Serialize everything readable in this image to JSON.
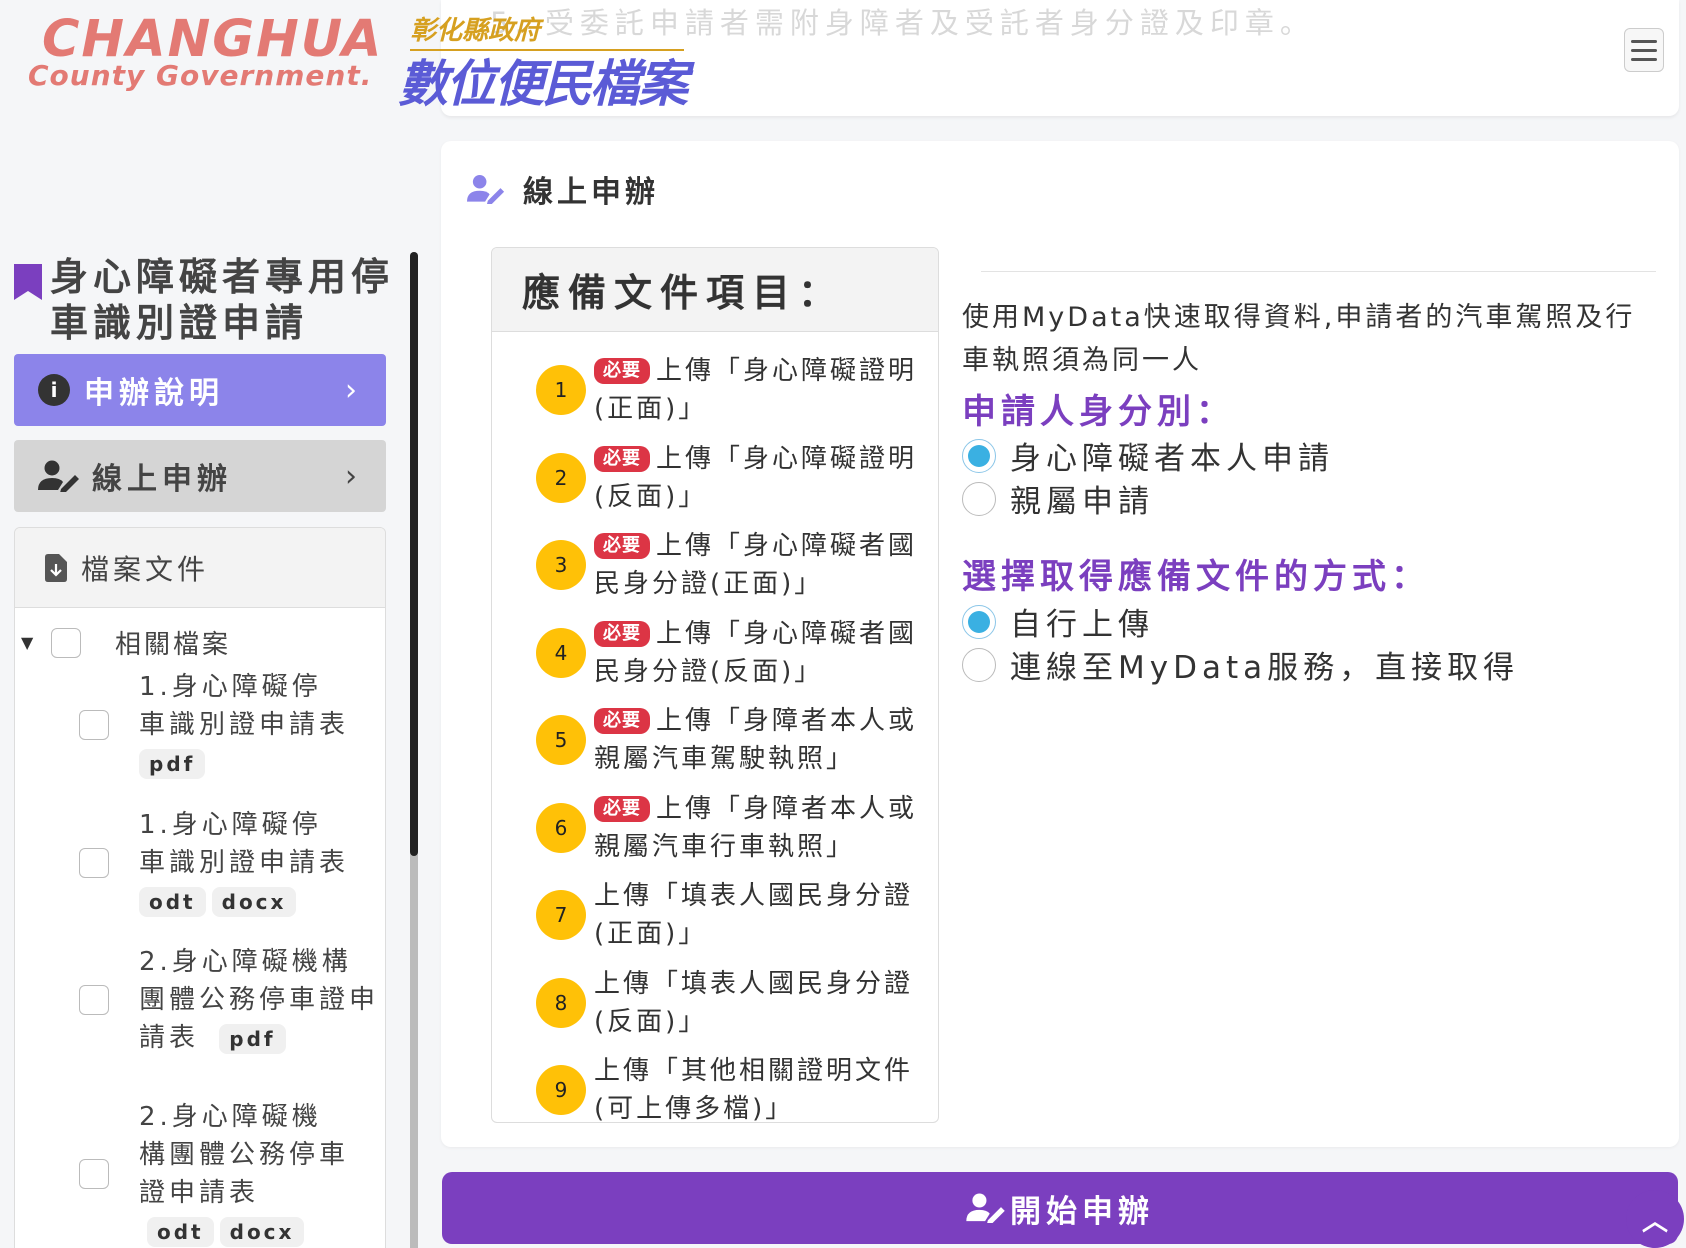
{
  "header": {
    "faded_note": "5. 受委託申請者需附身障者及受託者身分證及印章。",
    "logo_en_line1": "CHANGHUA",
    "logo_en_line2": "County Government.",
    "logo_zh_line1": "彰化縣政府",
    "logo_zh_line2": "數位便民檔案"
  },
  "sidebar": {
    "title": "身心障礙者專用停車識別證申請",
    "buttons": [
      {
        "label": "申辦說明"
      },
      {
        "label": "線上申辦"
      }
    ],
    "files": {
      "header": "檔案文件",
      "root_label": "相關檔案",
      "items": [
        {
          "label": "1.身心障礙停車識別證申請表",
          "tags": [
            "pdf"
          ]
        },
        {
          "label": "1.身心障礙停車識別證申請表",
          "tags": [
            "odt",
            "docx"
          ]
        },
        {
          "label": "2.身心障礙機構團體公務停車證申請表",
          "tags": [
            "pdf"
          ]
        },
        {
          "label": "2.身心障礙機構團體公務停車證申請表",
          "tags": [
            "odt",
            "docx"
          ]
        }
      ]
    }
  },
  "main": {
    "title": "線上申辦",
    "docs_header": "應備文件項目：",
    "required_badge": "必要",
    "docs": [
      {
        "num": "1",
        "text": "上傳「身心障礙證明(正面)」",
        "required": true
      },
      {
        "num": "2",
        "text": "上傳「身心障礙證明(反面)」",
        "required": true
      },
      {
        "num": "3",
        "text": "上傳「身心障礙者國民身分證(正面)」",
        "required": true
      },
      {
        "num": "4",
        "text": "上傳「身心障礙者國民身分證(反面)」",
        "required": true
      },
      {
        "num": "5",
        "text": "上傳「身障者本人或親屬汽車駕駛執照」",
        "required": true
      },
      {
        "num": "6",
        "text": "上傳「身障者本人或親屬汽車行車執照」",
        "required": true
      },
      {
        "num": "7",
        "text": "上傳「填表人國民身分證(正面)」",
        "required": false
      },
      {
        "num": "8",
        "text": "上傳「填表人國民身分證(反面)」",
        "required": false
      },
      {
        "num": "9",
        "text": "上傳「其他相關證明文件(可上傳多檔)」",
        "required": false
      }
    ],
    "mydata_note": "使用MyData快速取得資料,申請者的汽車駕照及行車執照須為同一人",
    "identity": {
      "title": "申請人身分別：",
      "options": [
        {
          "label": "身心障礙者本人申請",
          "selected": true
        },
        {
          "label": "親屬申請",
          "selected": false
        }
      ]
    },
    "method": {
      "title": "選擇取得應備文件的方式：",
      "options": [
        {
          "label": "自行上傳",
          "selected": true
        },
        {
          "label": "連線至MyData服務，直接取得",
          "selected": false
        }
      ]
    },
    "start_button": "開始申辦"
  },
  "colors": {
    "brand_purple": "#7b3fbf",
    "explain_button": "#8c84ea",
    "required_red": "#dc3545",
    "step_yellow": "#ffc107",
    "radio_blue": "#3ab0e2"
  },
  "icons": [
    "info-icon",
    "user-edit-icon",
    "chevron-right-icon",
    "file-download-icon",
    "bookmark-icon",
    "hamburger-icon",
    "chevron-up-icon"
  ]
}
